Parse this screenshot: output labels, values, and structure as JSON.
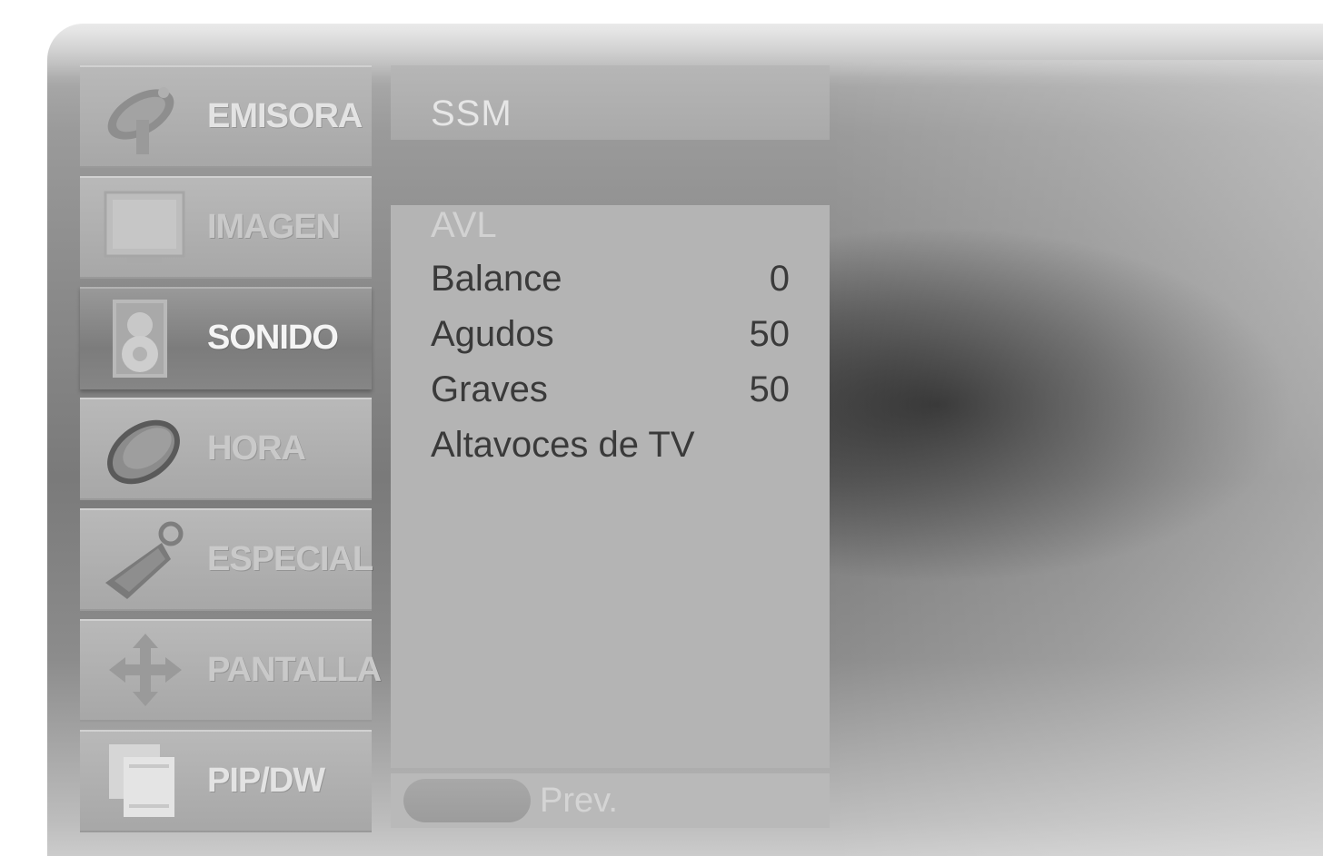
{
  "menu": {
    "items": [
      {
        "label": "EMISORA",
        "icon": "satellite-dish-icon",
        "active": false
      },
      {
        "label": "IMAGEN",
        "icon": "picture-monitor-icon",
        "active": false
      },
      {
        "label": "SONIDO",
        "icon": "speaker-icon",
        "active": true
      },
      {
        "label": "HORA",
        "icon": "clock-icon",
        "active": false
      },
      {
        "label": "ESPECIAL",
        "icon": "key-tag-icon",
        "active": false
      },
      {
        "label": "PANTALLA",
        "icon": "arrows-move-icon",
        "active": false
      },
      {
        "label": "PIP/DW",
        "icon": "pip-windows-icon",
        "active": false
      }
    ]
  },
  "submenu": {
    "header": "SSM",
    "rows": [
      {
        "label": "AVL",
        "value": "",
        "enabled": false
      },
      {
        "label": "Balance",
        "value": "0",
        "enabled": true
      },
      {
        "label": "Agudos",
        "value": "50",
        "enabled": true
      },
      {
        "label": "Graves",
        "value": "50",
        "enabled": true
      },
      {
        "label": "Altavoces de TV",
        "value": "",
        "enabled": true
      }
    ],
    "footer": {
      "prev_label": "Prev."
    }
  },
  "colors": {
    "panel_gray": "#a8a8a8",
    "active_item": "#7c7c7c",
    "submenu_bg": "#b4b4b4",
    "row_text": "#3a3a3a",
    "label_text": "#e3e3e3"
  }
}
